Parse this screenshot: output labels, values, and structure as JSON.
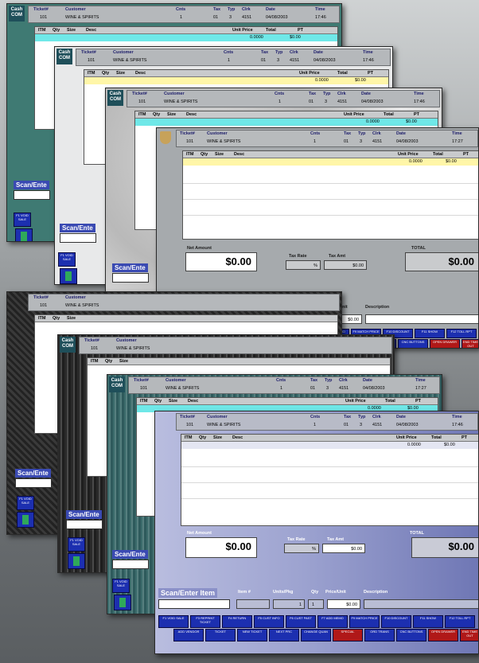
{
  "header_fields": {
    "ticket_label": "Ticket#",
    "customer_label": "Customer",
    "cnts_label": "Cnts",
    "tax_label": "Tax",
    "typ_label": "Typ",
    "clrk_label": "Clrk",
    "date_label": "Date",
    "time_label": "Time"
  },
  "header_values": {
    "ticket": "101",
    "customer": "WINE & SPIRITS",
    "cnts": "1",
    "tax": "01",
    "typ": "3",
    "clrk": "4151",
    "date": "04/08/2003",
    "time_a": "17:46",
    "time_b": "17:27"
  },
  "grid": {
    "columns": [
      "ITM",
      "Qty",
      "Size",
      "Desc",
      "Unit Price",
      "Total",
      "PT"
    ],
    "row_unit_price": "0.0000",
    "row_total": "$0.00"
  },
  "totals": {
    "net_amount_label": "Net Amount",
    "net_amount": "$0.00",
    "tax_rate_label": "Tax Rate",
    "tax_rate": "%",
    "tax_amt_label": "Tax Amt",
    "tax_amt": "$0.00",
    "total_label": "TOTAL",
    "total": "$0.00"
  },
  "scan": {
    "label": "Scan/Enter Item",
    "short_label": "Scan/Ente",
    "item_label": "Item #",
    "units_label": "Units/Pkg",
    "qty_label": "Qty",
    "price_label": "Price/Unit",
    "desc_label": "Description",
    "units": "1",
    "qty": "1",
    "price": "$0.00"
  },
  "function_keys_top": [
    "F1 VOID SALE",
    "F3 REPRINT TICKET",
    "F4 RETURN",
    "F5 CUST INFO",
    "F6 CUST PAST",
    "F7 ADD MEMO",
    "F9 MATCH PRICE",
    "F10 DISCOUNT",
    "F11 SHOW",
    "F12 TOLL RPT"
  ],
  "function_keys_bottom": [
    "ADD VENDOR",
    "TICKET",
    "NEW TICKET",
    "NEXT PRC",
    "CHANGE QUAN",
    "SPECIAL",
    "ORD TRANS",
    "CNC BUTTONS",
    "OPEN DRAWER",
    "END TIME OUT"
  ],
  "void_sale_label": "F1 VOID SALE",
  "colors": {
    "accent_blue": "#1c2fb0",
    "header_gray": "#b5b8bb",
    "grid_highlight_cyan": "#6fe8e8",
    "grid_highlight_yellow": "#fff6a8",
    "special_red": "#b01818"
  }
}
